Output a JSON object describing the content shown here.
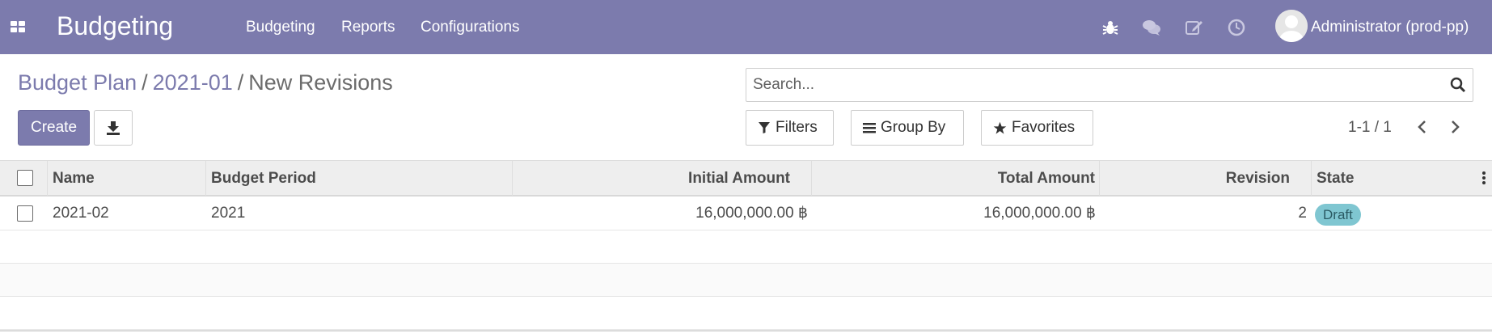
{
  "navbar": {
    "app_name": "Budgeting",
    "menu": [
      "Budgeting",
      "Reports",
      "Configurations"
    ],
    "user": "Administrator (prod-pp)",
    "icons": [
      "apps-icon",
      "bug-icon",
      "chat-icon",
      "edit-icon",
      "clock-icon",
      "avatar"
    ]
  },
  "breadcrumb": {
    "items": [
      "Budget Plan",
      "2021-01"
    ],
    "separator": "/",
    "current": "New Revisions"
  },
  "buttons": {
    "create": "Create",
    "filters": "Filters",
    "group_by": "Group By",
    "favorites": "Favorites"
  },
  "search": {
    "placeholder": "Search...",
    "value": ""
  },
  "pager": {
    "value": "1-1 / 1"
  },
  "table": {
    "columns": [
      "Name",
      "Budget Period",
      "Initial Amount",
      "Total Amount",
      "Revision",
      "State"
    ],
    "rows": [
      {
        "name": "2021-02",
        "period": "2021",
        "initial": "16,000,000.00 ฿",
        "total": "16,000,000.00 ฿",
        "revision": "2",
        "state": "Draft"
      }
    ]
  },
  "colors": {
    "primary": "#7c7bad",
    "badge_draft": "#7fc6d1"
  }
}
